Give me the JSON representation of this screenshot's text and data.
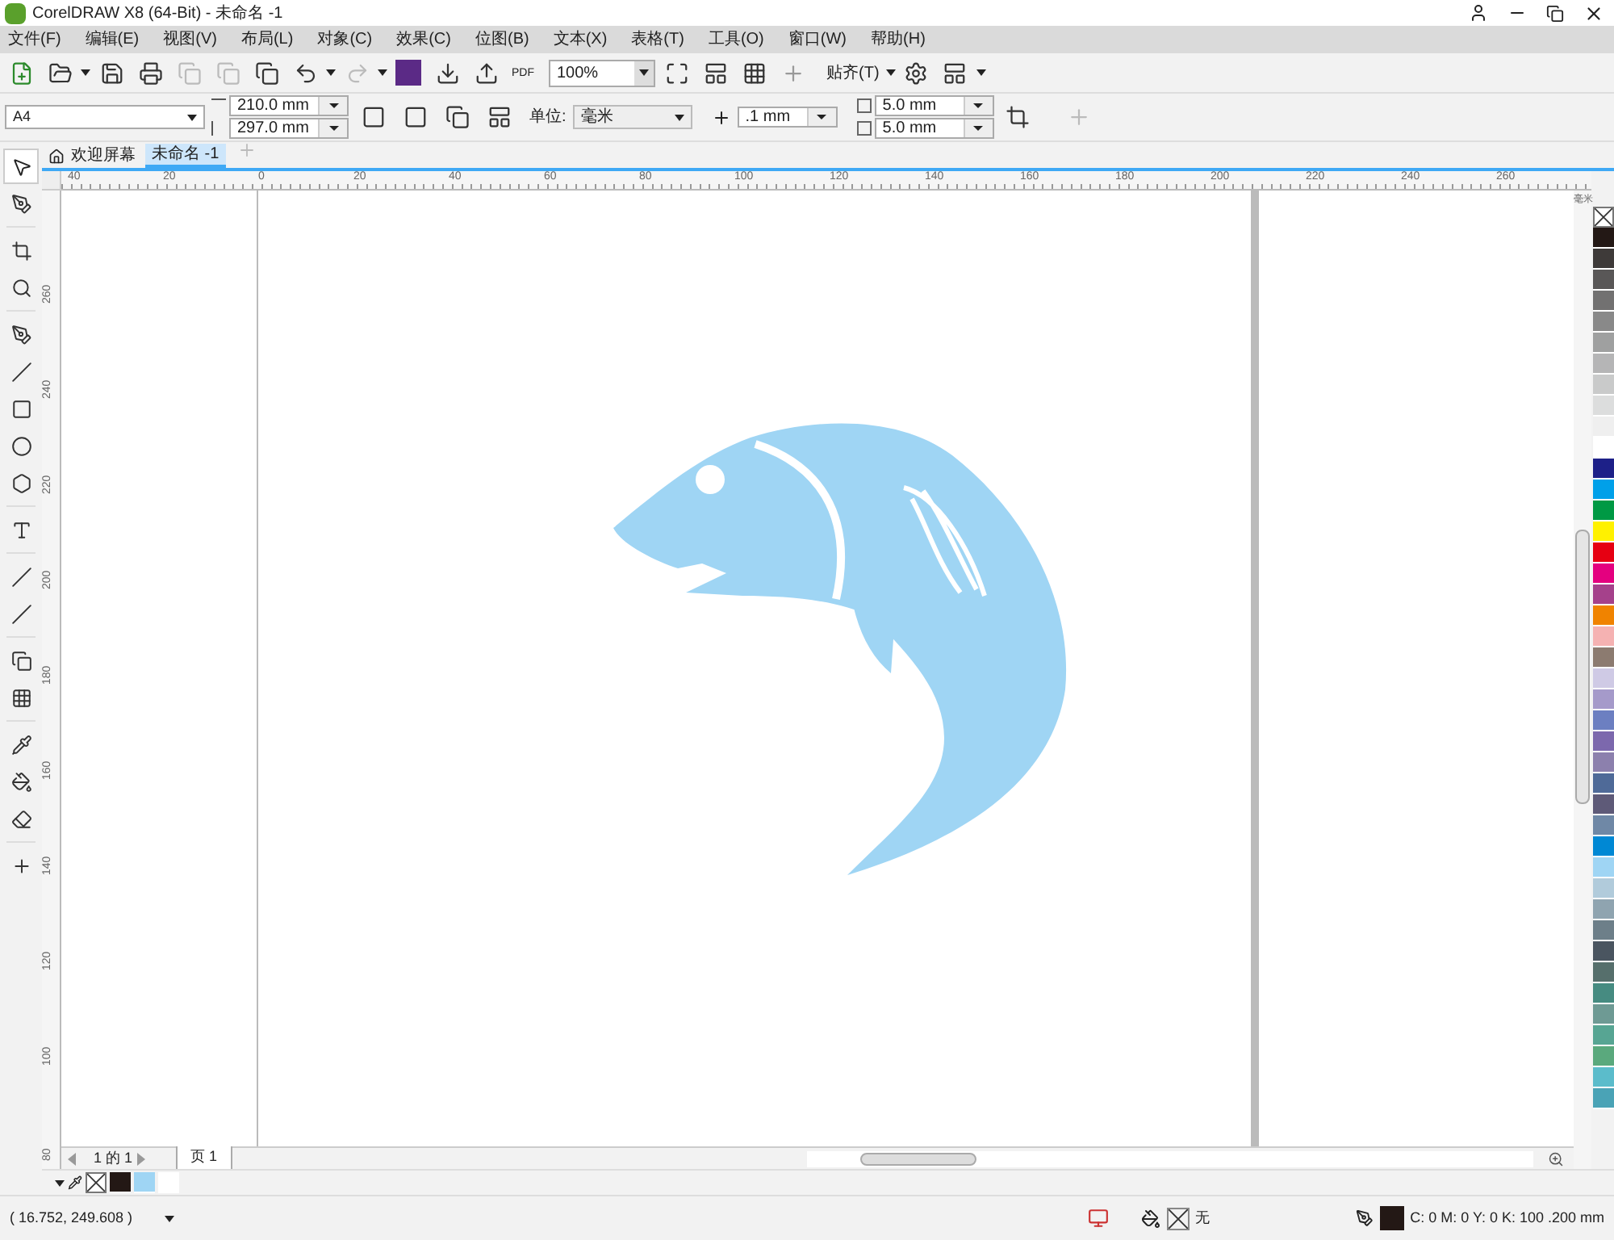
{
  "window": {
    "title": "CorelDRAW X8 (64-Bit) - 未命名 -1"
  },
  "menu": [
    "文件(F)",
    "编辑(E)",
    "视图(V)",
    "布局(L)",
    "对象(C)",
    "效果(C)",
    "位图(B)",
    "文本(X)",
    "表格(T)",
    "工具(O)",
    "窗口(W)",
    "帮助(H)"
  ],
  "toolbar": {
    "zoom": "100%",
    "snap": "贴齐(T)",
    "pdf_label": "PDF"
  },
  "property_bar": {
    "page_size": "A4",
    "width": "210.0 mm",
    "height": "297.0 mm",
    "units_label": "单位:",
    "units": "毫米",
    "nudge": ".1 mm",
    "dup_x": "5.0 mm",
    "dup_y": "5.0 mm"
  },
  "tabs": [
    {
      "label": "欢迎屏幕",
      "selected": false
    },
    {
      "label": "未命名 -1",
      "selected": true
    }
  ],
  "rulers": {
    "horizontal": [
      "40",
      "20",
      "0",
      "20",
      "40",
      "60",
      "80",
      "100",
      "120",
      "140",
      "160",
      "180",
      "200",
      "220",
      "240",
      "260"
    ],
    "vertical": [
      "260",
      "240",
      "220",
      "200",
      "180",
      "160",
      "140",
      "120",
      "100",
      "80"
    ],
    "units": "毫米"
  },
  "page_nav": {
    "counter": "1 的 1",
    "page_tab": "页 1"
  },
  "document_palette": [
    {
      "kind": "none"
    },
    {
      "kind": "swatch",
      "color": "#231815"
    },
    {
      "kind": "swatch",
      "color": "#9fd5f4"
    },
    {
      "kind": "swatch",
      "color": "#ffffff"
    }
  ],
  "palette": [
    {
      "kind": "none"
    },
    {
      "kind": "swatch",
      "color": "#231815"
    },
    {
      "kind": "swatch",
      "color": "#3e3a39"
    },
    {
      "kind": "swatch",
      "color": "#595757"
    },
    {
      "kind": "swatch",
      "color": "#727171"
    },
    {
      "kind": "swatch",
      "color": "#898989"
    },
    {
      "kind": "swatch",
      "color": "#9fa0a0"
    },
    {
      "kind": "swatch",
      "color": "#b5b5b6"
    },
    {
      "kind": "swatch",
      "color": "#c9caca"
    },
    {
      "kind": "swatch",
      "color": "#dcdddd"
    },
    {
      "kind": "swatch",
      "color": "#efefef"
    },
    {
      "kind": "swatch",
      "color": "#ffffff"
    },
    {
      "kind": "swatch",
      "color": "#1d2088"
    },
    {
      "kind": "swatch",
      "color": "#00a0e9"
    },
    {
      "kind": "swatch",
      "color": "#009944"
    },
    {
      "kind": "swatch",
      "color": "#fff100"
    },
    {
      "kind": "swatch",
      "color": "#e60012"
    },
    {
      "kind": "swatch",
      "color": "#e4007f"
    },
    {
      "kind": "swatch",
      "color": "#a5418b"
    },
    {
      "kind": "swatch",
      "color": "#f08300"
    },
    {
      "kind": "swatch",
      "color": "#f5b2b2"
    },
    {
      "kind": "swatch",
      "color": "#8c7b70"
    },
    {
      "kind": "swatch",
      "color": "#cfcae5"
    },
    {
      "kind": "swatch",
      "color": "#a59aca"
    },
    {
      "kind": "swatch",
      "color": "#6c7fc1"
    },
    {
      "kind": "swatch",
      "color": "#7c68ad"
    },
    {
      "kind": "swatch",
      "color": "#8c80ad"
    },
    {
      "kind": "swatch",
      "color": "#4f6a98"
    },
    {
      "kind": "swatch",
      "color": "#5e5a78"
    },
    {
      "kind": "swatch",
      "color": "#6f88a6"
    },
    {
      "kind": "swatch",
      "color": "#0088d4"
    },
    {
      "kind": "swatch",
      "color": "#9fd5f4"
    },
    {
      "kind": "swatch",
      "color": "#b1cbdb"
    },
    {
      "kind": "swatch",
      "color": "#8fa4b0"
    },
    {
      "kind": "swatch",
      "color": "#6d7f89"
    },
    {
      "kind": "swatch",
      "color": "#4a5560"
    },
    {
      "kind": "swatch",
      "color": "#566f6c"
    },
    {
      "kind": "swatch",
      "color": "#468b81"
    },
    {
      "kind": "swatch",
      "color": "#6e9a94"
    },
    {
      "kind": "swatch",
      "color": "#57a593"
    },
    {
      "kind": "swatch",
      "color": "#5aa97d"
    },
    {
      "kind": "swatch",
      "color": "#5bbccb"
    },
    {
      "kind": "swatch",
      "color": "#4aa3b6"
    }
  ],
  "status_bar": {
    "coordinates": "( 16.752, 249.608 )",
    "fill_label": "无",
    "outline": "C: 0 M: 0 Y: 0 K: 100  .200 mm"
  }
}
